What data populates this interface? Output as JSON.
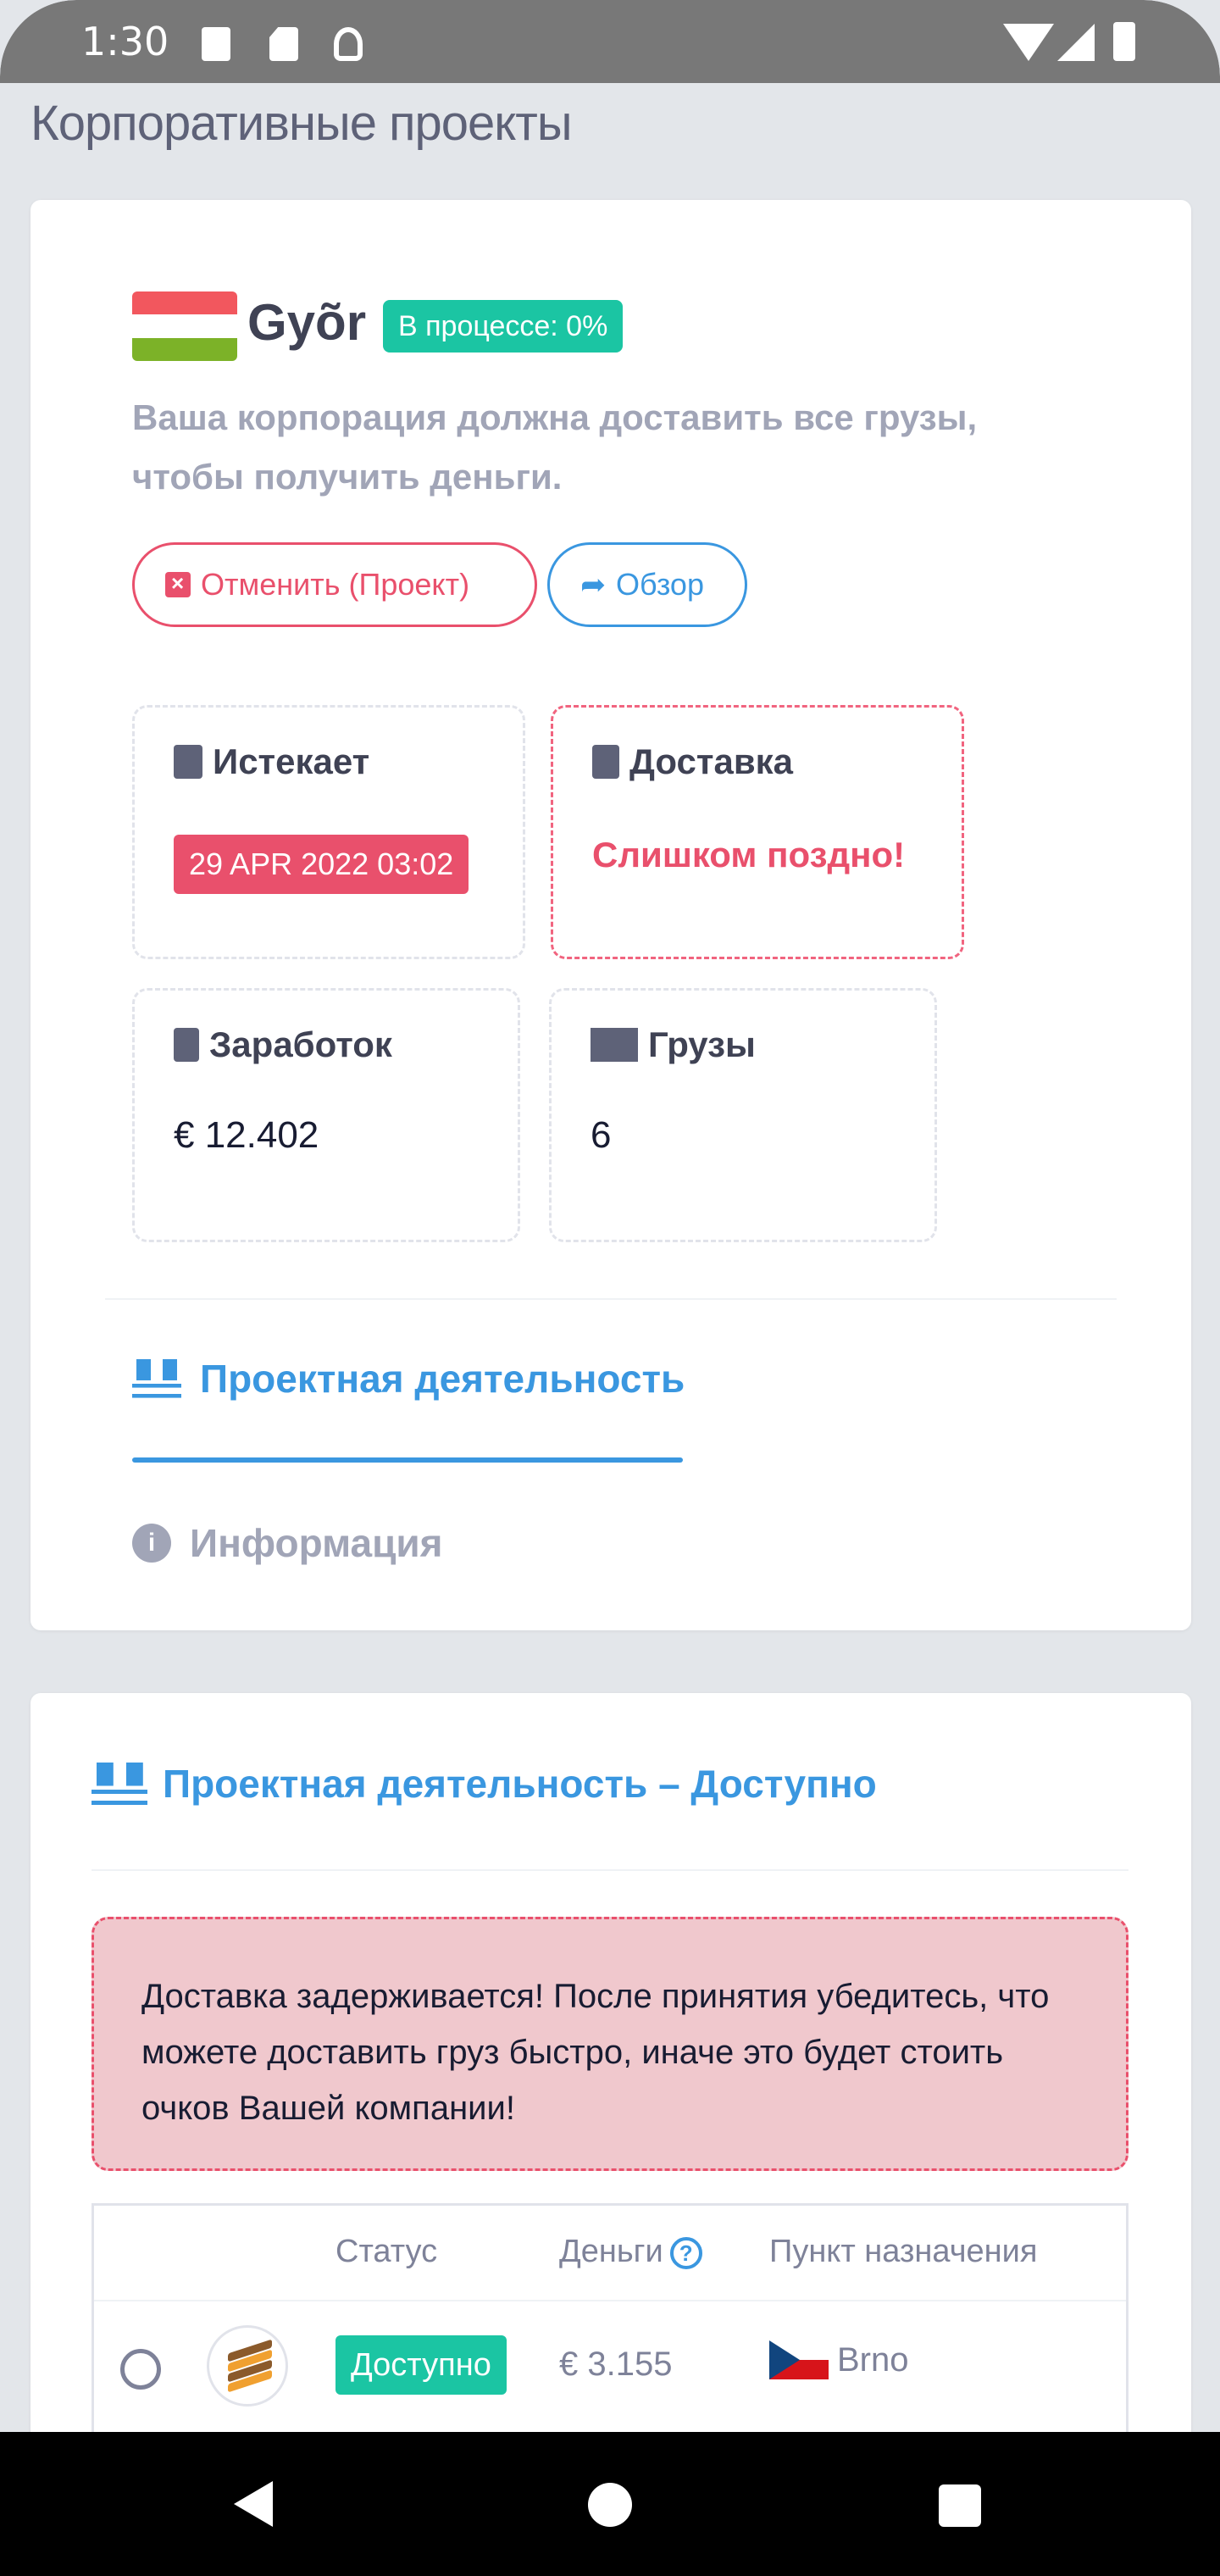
{
  "status_bar": {
    "time": "1:30"
  },
  "page": {
    "title": "Корпоративные проекты"
  },
  "project": {
    "name": "Gyõr",
    "flag_colors": [
      "#f2575e",
      "#ffffff",
      "#7cb228"
    ],
    "progress_badge": "В процессе: 0%",
    "description": "Ваша корпорация должна доставить все грузы, чтобы получить деньги.",
    "cancel_label": "Отменить (Проект)",
    "review_label": "Обзор"
  },
  "stats": {
    "expires_label": "Истекает",
    "expires_value": "29 APR 2022 03:02",
    "delivery_label": "Доставка",
    "delivery_value": "Слишком поздно!",
    "earnings_label": "Заработок",
    "earnings_value": "€ 12.402",
    "cargo_label": "Грузы",
    "cargo_value": "6"
  },
  "tabs": {
    "activity": "Проектная деятельность",
    "info": "Информация"
  },
  "section": {
    "title": "Проектная деятельность – Доступно",
    "alert": "Доставка задерживается! После принятия убедитесь, что можете доставить груз быстро, иначе это будет стоить очков Вашей компании!"
  },
  "table": {
    "headers": {
      "status": "Статус",
      "money": "Деньги",
      "destination": "Пункт назначения"
    },
    "rows": [
      {
        "status": "Доступно",
        "money": "€ 3.155",
        "destination": "Brno"
      }
    ]
  },
  "colors": {
    "accent": "#3a97e0",
    "danger": "#e9506c",
    "success": "#1bc5a3"
  }
}
